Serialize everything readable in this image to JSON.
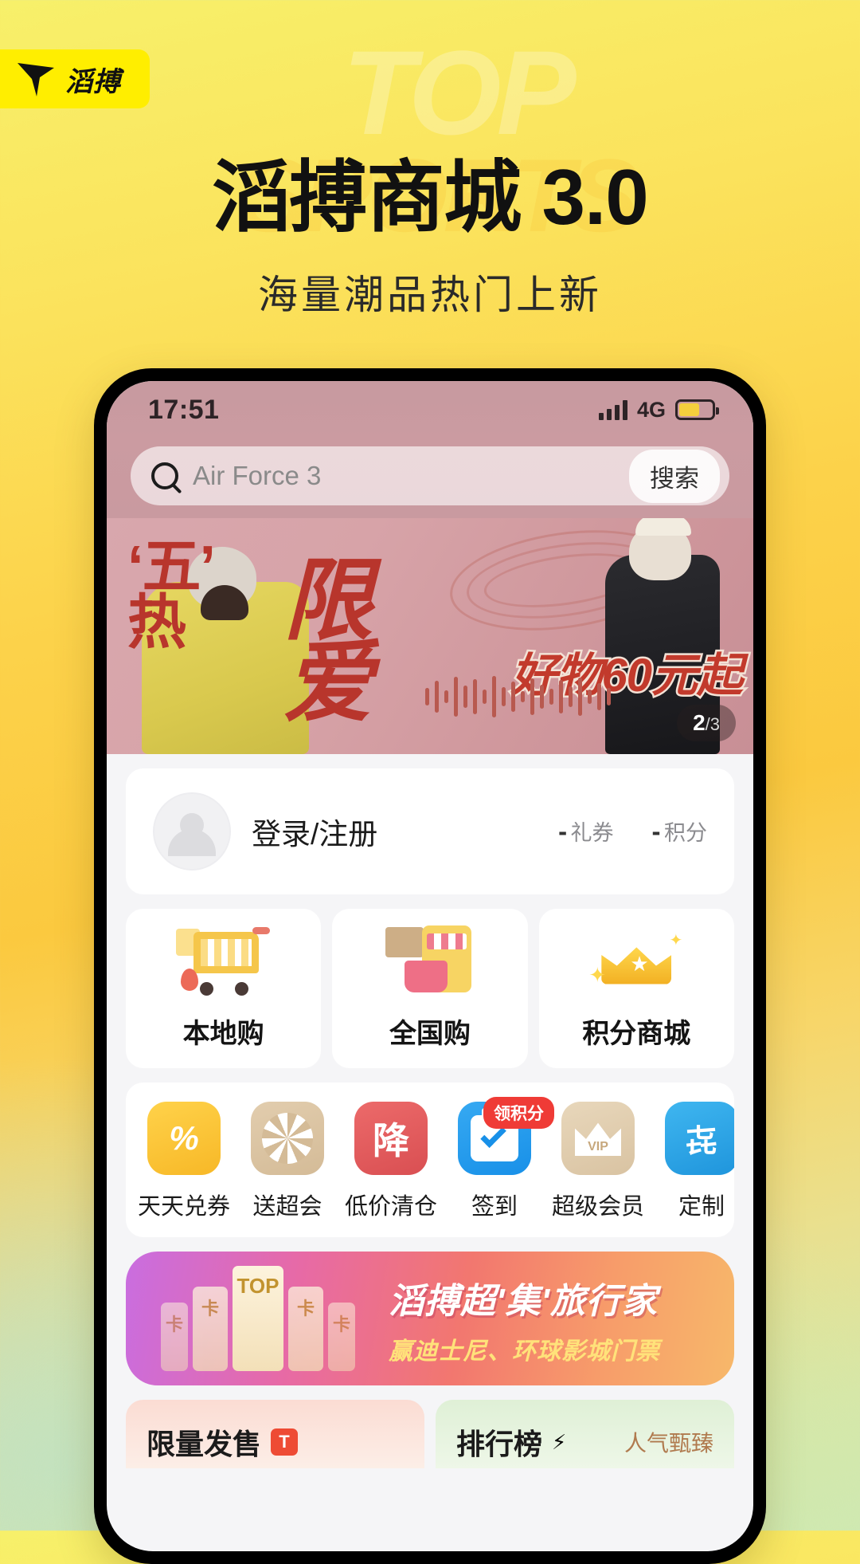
{
  "brand": {
    "logo_text": "滔搏",
    "logo_mark": "t-arrow-logo-icon",
    "ghost_text_1": "TOP",
    "ghost_text_2": "SPORTS"
  },
  "hero": {
    "title": "滔搏商城 3.0",
    "subtitle": "海量潮品热门上新"
  },
  "phone": {
    "status_bar": {
      "time": "17:51",
      "network": "4G",
      "signal_icon": "signal-bars-icon",
      "battery_icon": "battery-icon"
    },
    "search": {
      "placeholder": "Air Force 3",
      "button_label": "搜索",
      "icon": "search-icon"
    },
    "banner": {
      "word_1": "‘五’",
      "word_2": "热",
      "word_3": "限",
      "word_4": "爱",
      "price_text": "好物60元起",
      "indicator_current": "2",
      "indicator_total": "/3"
    },
    "user_card": {
      "login_label": "登录/注册",
      "avatar_icon": "avatar-icon",
      "stats": [
        {
          "value": "-",
          "label": "礼券"
        },
        {
          "value": "-",
          "label": "积分"
        }
      ]
    },
    "categories": [
      {
        "label": "本地购",
        "icon": "shopping-cart-icon"
      },
      {
        "label": "全国购",
        "icon": "storefront-phone-icon"
      },
      {
        "label": "积分商城",
        "icon": "crown-icon"
      }
    ],
    "quick_icons": [
      {
        "label": "天天兑券",
        "icon": "coupon-percent-icon",
        "badge": ""
      },
      {
        "label": "送超会",
        "icon": "prize-wheel-icon",
        "badge": ""
      },
      {
        "label": "低价清仓",
        "icon": "price-drop-icon",
        "badge": ""
      },
      {
        "label": "签到",
        "icon": "calendar-check-icon",
        "badge": "领积分"
      },
      {
        "label": "超级会员",
        "icon": "vip-crown-icon",
        "badge": ""
      },
      {
        "label": "定制",
        "icon": "customize-icon",
        "badge": ""
      }
    ],
    "promo_banner": {
      "card_text": "卡",
      "card_center": "TOP",
      "title": "滔搏超'集'旅行家",
      "subtitle": "赢迪士尼、环球影城门票"
    },
    "bottom_tiles": [
      {
        "title": "限量发售",
        "mini_icon": "t-brand-icon",
        "sub": ""
      },
      {
        "title": "排行榜",
        "mini_icon": "lightning-icon",
        "sub": "人气甄臻"
      }
    ]
  },
  "colors": {
    "brand_yellow": "#ffee00",
    "page_gradient_start": "#f7f06a",
    "page_gradient_end": "#cfe9b4",
    "banner_red": "#b8352c",
    "badge_red": "#ef3b36"
  }
}
